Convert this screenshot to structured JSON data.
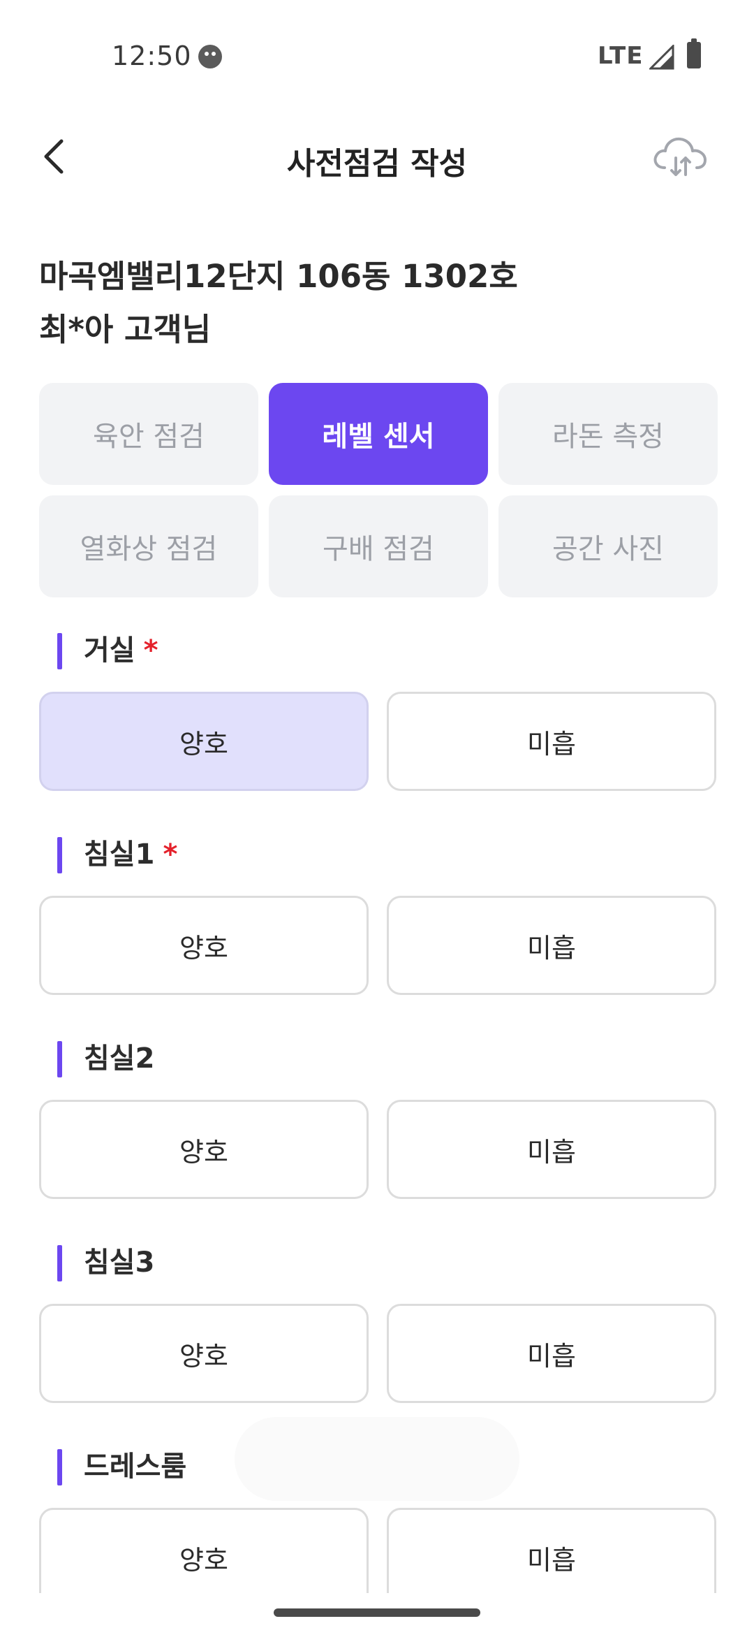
{
  "status_bar": {
    "time": "12:50",
    "network": "LTE",
    "icons": [
      "face-notification-icon",
      "signal-icon",
      "battery-icon"
    ]
  },
  "header": {
    "title": "사전점검 작성",
    "back_icon": "chevron-left-icon",
    "upload_icon": "cloud-sync-icon"
  },
  "address": {
    "line1": "마곡엠밸리12단지 106동 1302호",
    "line2": "최*아 고객님"
  },
  "tabs": [
    {
      "label": "육안 점검",
      "active": false
    },
    {
      "label": "레벨 센서",
      "active": true
    },
    {
      "label": "라돈 측정",
      "active": false
    },
    {
      "label": "열화상 점검",
      "active": false
    },
    {
      "label": "구배 점검",
      "active": false
    },
    {
      "label": "공간 사진",
      "active": false
    }
  ],
  "sections": [
    {
      "title": "거실",
      "required": true,
      "required_mark": "*",
      "options": [
        "양호",
        "미흡"
      ],
      "selected": "양호"
    },
    {
      "title": "침실1",
      "required": true,
      "required_mark": "*",
      "options": [
        "양호",
        "미흡"
      ],
      "selected": null
    },
    {
      "title": "침실2",
      "required": false,
      "options": [
        "양호",
        "미흡"
      ],
      "selected": null
    },
    {
      "title": "침실3",
      "required": false,
      "options": [
        "양호",
        "미흡"
      ],
      "selected": null
    },
    {
      "title": "드레스룸",
      "required": false,
      "options": [
        "양호",
        "미흡"
      ],
      "selected": null
    }
  ],
  "colors": {
    "accent": "#6c47f0",
    "selected_option_bg": "#e1e0fc",
    "required_mark": "#e4212b",
    "tab_inactive_bg": "#f2f3f5"
  }
}
